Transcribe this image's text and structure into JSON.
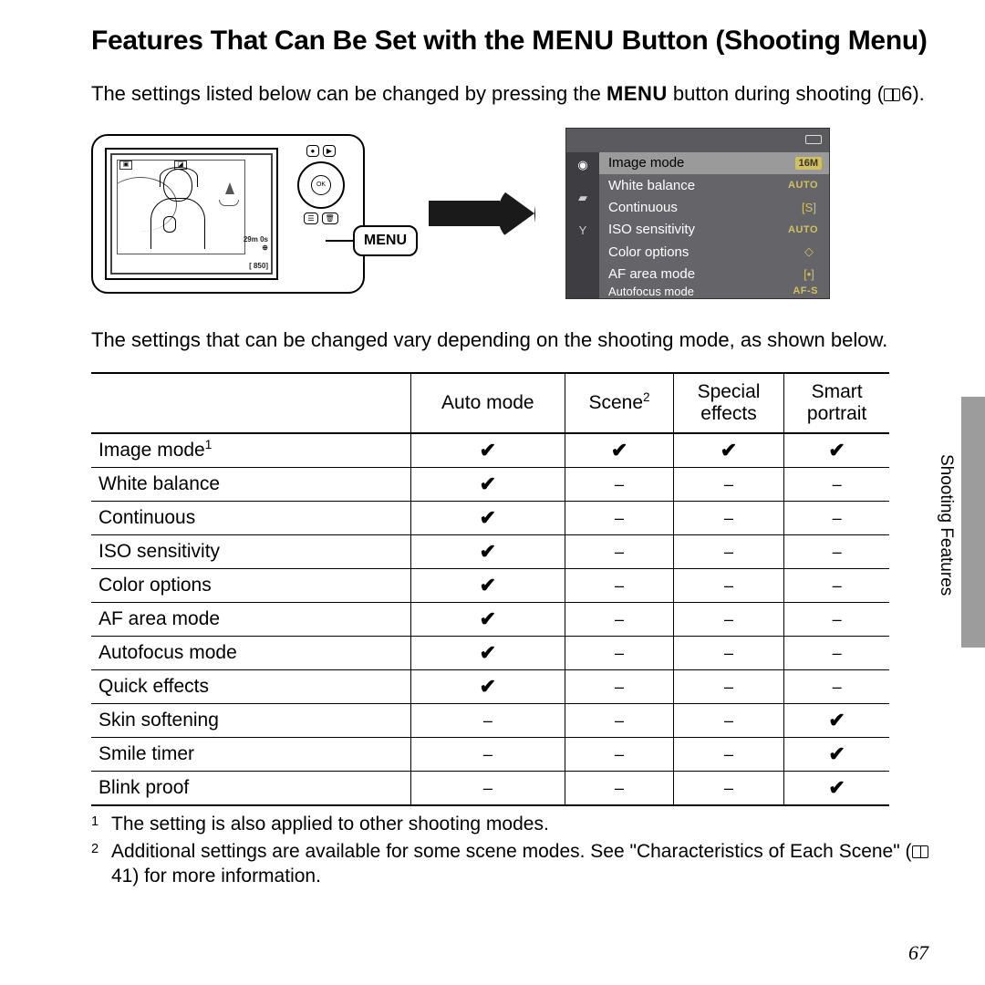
{
  "title_pre": "Features That Can Be Set with the ",
  "title_menu": "MENU",
  "title_post": " Button (Shooting Menu)",
  "intro_pre": "The settings listed below can be changed by pressing the ",
  "intro_menu": "MENU",
  "intro_post": " button during shooting (",
  "intro_ref": "6).",
  "menu_button_label": "MENU",
  "screen_menu": {
    "rows": [
      {
        "label": "Image mode",
        "value": "16M",
        "cls": "box",
        "hl": true
      },
      {
        "label": "White balance",
        "value": "AUTO",
        "cls": "auto"
      },
      {
        "label": "Continuous",
        "value": "[S]",
        "cls": "glyph"
      },
      {
        "label": "ISO sensitivity",
        "value": "AUTO",
        "cls": "auto"
      },
      {
        "label": "Color options",
        "value": "◇",
        "cls": "glyph"
      },
      {
        "label": "AF area mode",
        "value": "[•]",
        "cls": "glyph"
      },
      {
        "label": "Autofocus mode",
        "value": "AF-S",
        "cls": "auto",
        "cut": true
      }
    ]
  },
  "note2": "The settings that can be changed vary depending on the shooting mode, as shown below.",
  "table": {
    "columns": [
      "Auto mode",
      "Scene",
      "Special effects",
      "Smart portrait"
    ],
    "col_sup": [
      "",
      "2",
      "",
      ""
    ],
    "rows": [
      {
        "label": "Image mode",
        "sup": "1",
        "cells": [
          "c",
          "c",
          "c",
          "c"
        ]
      },
      {
        "label": "White balance",
        "sup": "",
        "cells": [
          "c",
          "d",
          "d",
          "d"
        ]
      },
      {
        "label": "Continuous",
        "sup": "",
        "cells": [
          "c",
          "d",
          "d",
          "d"
        ]
      },
      {
        "label": "ISO sensitivity",
        "sup": "",
        "cells": [
          "c",
          "d",
          "d",
          "d"
        ]
      },
      {
        "label": "Color options",
        "sup": "",
        "cells": [
          "c",
          "d",
          "d",
          "d"
        ]
      },
      {
        "label": "AF area mode",
        "sup": "",
        "cells": [
          "c",
          "d",
          "d",
          "d"
        ]
      },
      {
        "label": "Autofocus mode",
        "sup": "",
        "cells": [
          "c",
          "d",
          "d",
          "d"
        ]
      },
      {
        "label": "Quick effects",
        "sup": "",
        "cells": [
          "c",
          "d",
          "d",
          "d"
        ]
      },
      {
        "label": "Skin softening",
        "sup": "",
        "cells": [
          "d",
          "d",
          "d",
          "c"
        ]
      },
      {
        "label": "Smile timer",
        "sup": "",
        "cells": [
          "d",
          "d",
          "d",
          "c"
        ]
      },
      {
        "label": "Blink proof",
        "sup": "",
        "cells": [
          "d",
          "d",
          "d",
          "c"
        ]
      }
    ]
  },
  "footnotes": [
    "The setting is also applied to other shooting modes.",
    "Additional settings are available for some scene modes. See \"Characteristics of Each Scene\" ("
  ],
  "footnote2_ref": "41) for more information.",
  "side_label": "Shooting Features",
  "page_number": "67"
}
